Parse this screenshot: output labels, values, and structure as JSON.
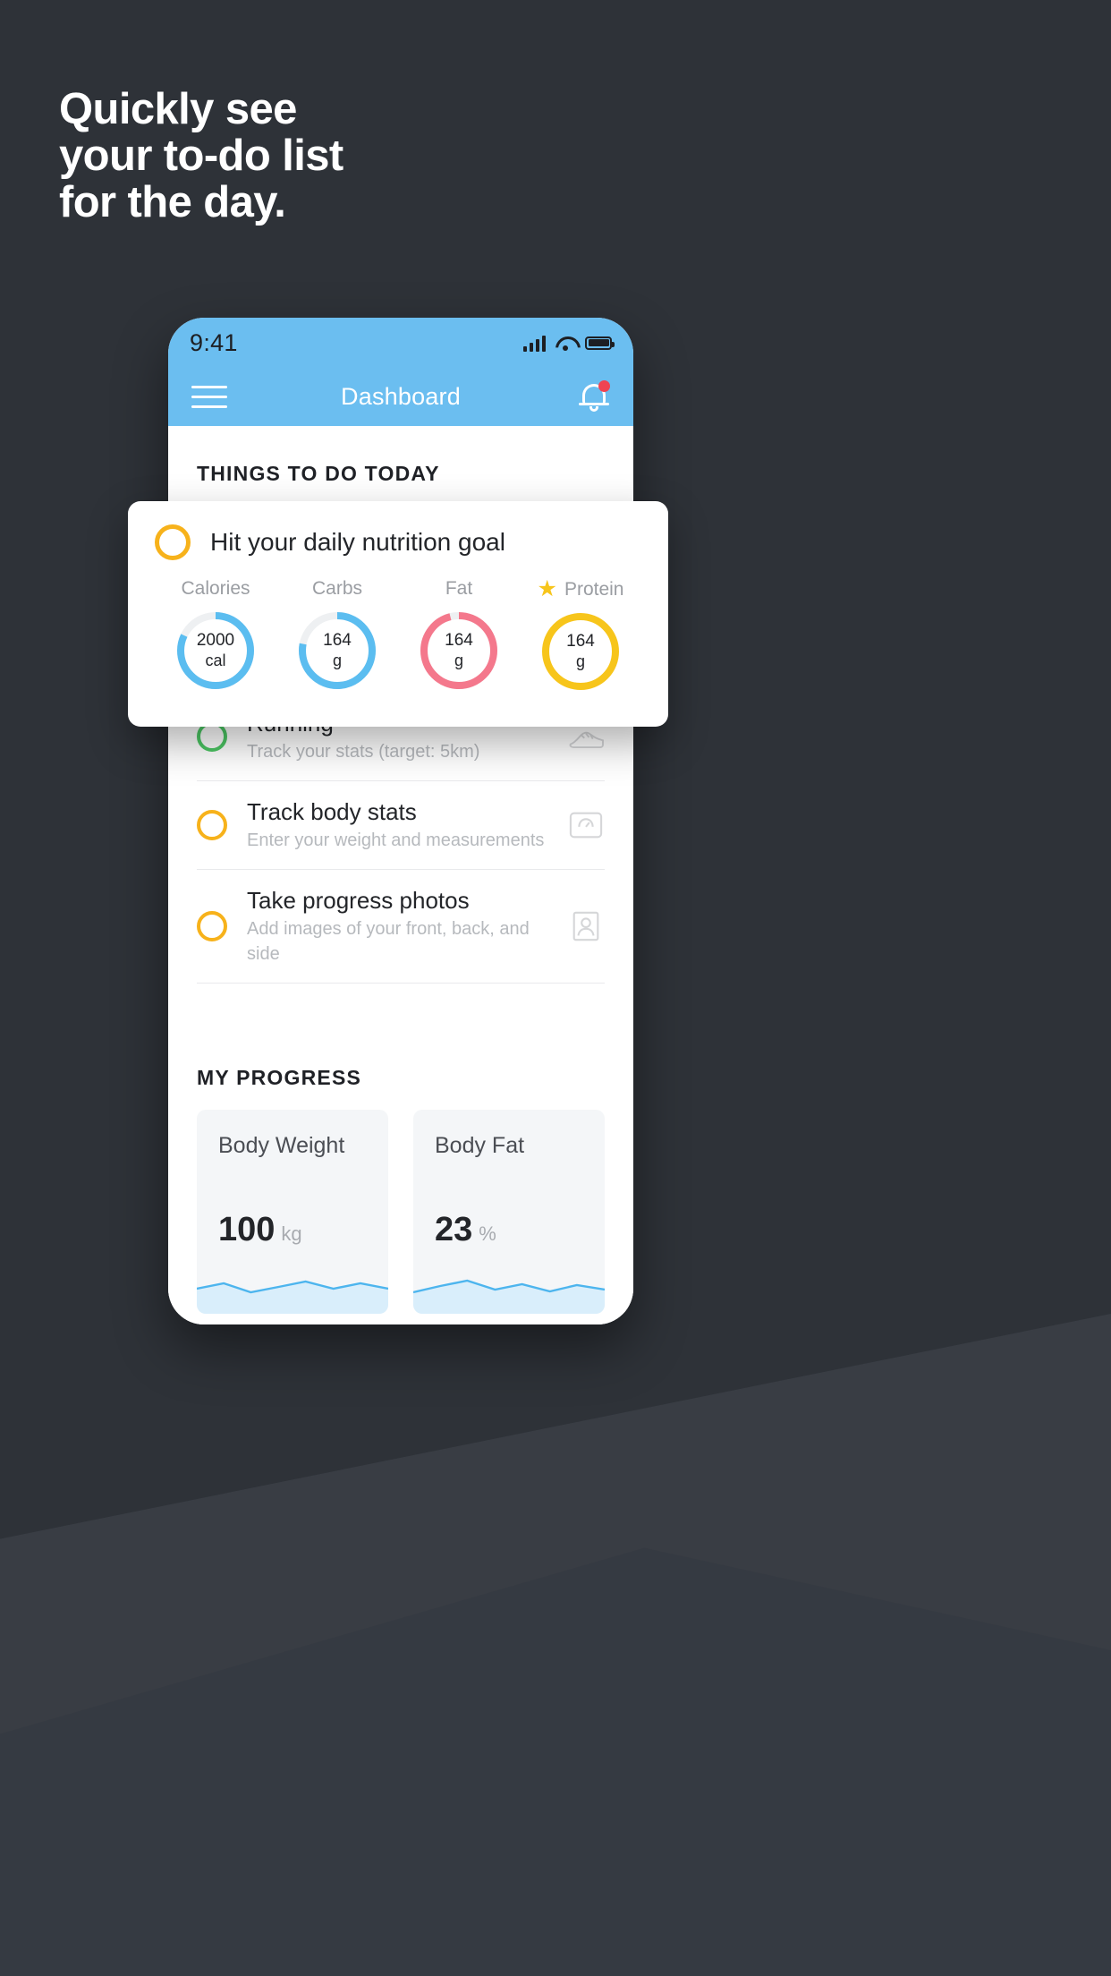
{
  "headline": {
    "line1": "Quickly see",
    "line2": "your to-do list",
    "line3": "for the day."
  },
  "phone": {
    "status_bar": {
      "time": "9:41",
      "signal_icon": "signal-bars-icon",
      "wifi_icon": "wifi-icon",
      "battery_icon": "battery-full-icon"
    },
    "app_bar": {
      "menu_icon": "hamburger-menu-icon",
      "title": "Dashboard",
      "bell_icon": "notification-bell-icon",
      "has_badge": true
    },
    "todo_section": {
      "heading": "THINGS TO DO TODAY",
      "tasks": [
        {
          "title": "Running",
          "subtitle": "Track your stats (target: 5km)",
          "ring_color": "#4cc764",
          "icon": "running-shoe-icon"
        },
        {
          "title": "Track body stats",
          "subtitle": "Enter your weight and measurements",
          "ring_color": "#f7b21b",
          "icon": "scale-icon"
        },
        {
          "title": "Take progress photos",
          "subtitle": "Add images of your front, back, and side",
          "ring_color": "#f7b21b",
          "icon": "portrait-photo-icon"
        }
      ]
    },
    "progress_section": {
      "heading": "MY PROGRESS",
      "cards": [
        {
          "title": "Body Weight",
          "value": "100",
          "unit": "kg"
        },
        {
          "title": "Body Fat",
          "value": "23",
          "unit": "%"
        }
      ]
    }
  },
  "nutrition_card": {
    "ring_color": "#f7b21b",
    "title": "Hit your daily nutrition goal",
    "macros": [
      {
        "label": "Calories",
        "value": "2000",
        "unit": "cal",
        "color": "#5bbdf0",
        "percent": 82,
        "starred": false
      },
      {
        "label": "Carbs",
        "value": "164",
        "unit": "g",
        "color": "#5bbdf0",
        "percent": 78,
        "starred": false
      },
      {
        "label": "Fat",
        "value": "164",
        "unit": "g",
        "color": "#f4788c",
        "percent": 96,
        "starred": false
      },
      {
        "label": "Protein",
        "value": "164",
        "unit": "g",
        "color": "#f7c51b",
        "percent": 100,
        "starred": true
      }
    ],
    "star_glyph": "★"
  },
  "colors": {
    "backdrop": "#2e3238",
    "brand_blue": "#6bbef0",
    "amber": "#f7b21b",
    "green": "#4cc764",
    "red_badge": "#ef4452"
  },
  "chart_data": [
    {
      "type": "line",
      "title": "Body Weight",
      "ylabel": "kg",
      "values": [
        100,
        99,
        101,
        100,
        99,
        100,
        101,
        100
      ],
      "color": "#5bbdf0"
    },
    {
      "type": "line",
      "title": "Body Fat",
      "ylabel": "%",
      "values": [
        23,
        24,
        23,
        22,
        24,
        23,
        22,
        23
      ],
      "color": "#5bbdf0"
    }
  ]
}
